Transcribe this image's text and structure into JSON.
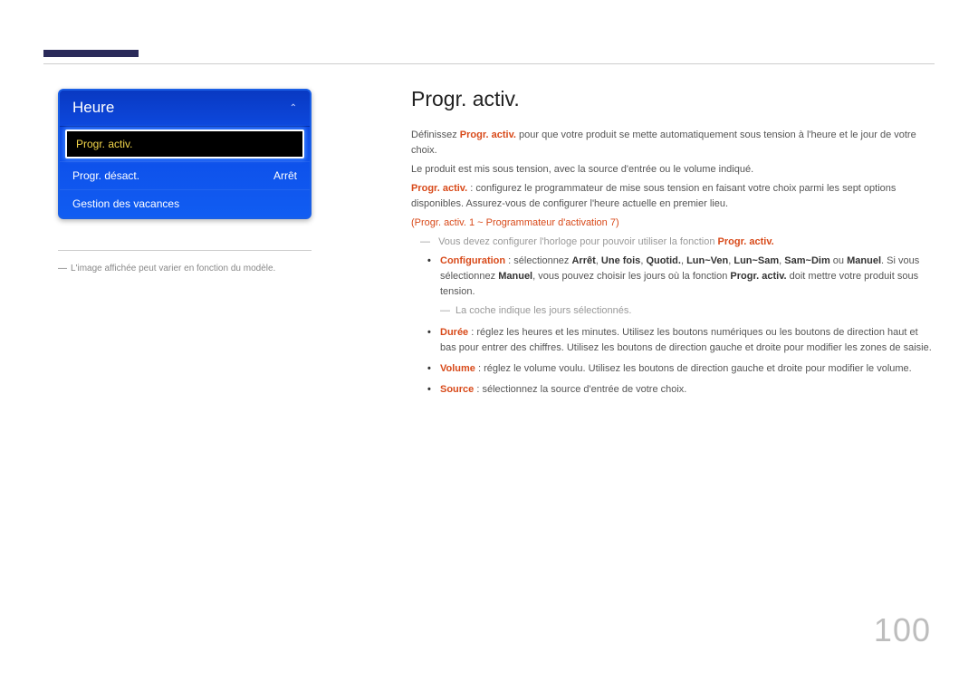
{
  "menu": {
    "title": "Heure",
    "items": [
      {
        "label": "Progr. activ.",
        "value": "",
        "selected": true
      },
      {
        "label": "Progr. désact.",
        "value": "Arrêt",
        "selected": false
      },
      {
        "label": "Gestion des vacances",
        "value": "",
        "selected": false
      }
    ]
  },
  "left_note": "L'image affichée peut varier en fonction du modèle.",
  "right": {
    "title": "Progr. activ.",
    "intro_prefix": "Définissez ",
    "intro_accent": "Progr. activ.",
    "intro_suffix": " pour que votre produit se mette automatiquement sous tension à l'heure et le jour de votre choix.",
    "line2": "Le produit est mis sous tension, avec la source d'entrée ou le volume indiqué.",
    "line3_accent": "Progr. activ.",
    "line3_text": " : configurez le programmateur de mise sous tension en faisant votre choix parmi les sept options disponibles. Assurez-vous de configurer l'heure actuelle en premier lieu.",
    "range_text": "(Progr. activ. 1 ~ Programmateur d'activation 7)",
    "note1_text": "Vous devez configurer l'horloge pour pouvoir utiliser la fonction ",
    "note1_accent": "Progr. activ.",
    "bullets": {
      "config_label": "Configuration",
      "config_pre": " : sélectionnez ",
      "opts": [
        "Arrêt",
        "Une fois",
        "Quotid.",
        "Lun~Ven",
        "Lun~Sam",
        "Sam~Dim"
      ],
      "opt_joiner": ", ",
      "opt_or": " ou ",
      "opt_manuel": "Manuel",
      "config_post1": ". Si vous sélectionnez ",
      "config_post2": ", vous pouvez choisir les jours où la fonction ",
      "config_accent2": "Progr. activ.",
      "config_post3": " doit mettre votre produit sous tension.",
      "config_inner_note": "La coche indique les jours sélectionnés.",
      "duree_label": "Durée",
      "duree_text": " : réglez les heures et les minutes. Utilisez les boutons numériques ou les boutons de direction haut et bas pour entrer des chiffres. Utilisez les boutons de direction gauche et droite pour modifier les zones de saisie.",
      "volume_label": "Volume",
      "volume_text": " : réglez le volume voulu. Utilisez les boutons de direction gauche et droite pour modifier le volume.",
      "source_label": "Source",
      "source_text": " : sélectionnez la source d'entrée de votre choix."
    }
  },
  "page_number": "100"
}
